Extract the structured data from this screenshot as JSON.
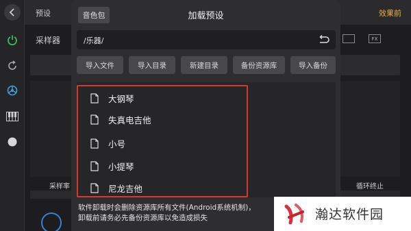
{
  "topbar": {
    "preset_label": "预设",
    "effect_label": "效果前"
  },
  "background": {
    "sampler_label": "采样器",
    "rate_label": "采样率",
    "loop_label": "循环终止",
    "fx_label": "FX"
  },
  "dialog": {
    "pack_button": "音色包",
    "title": "加载预设",
    "path": "/乐器/",
    "actions": [
      {
        "label": "导入文件"
      },
      {
        "label": "导入目录"
      },
      {
        "label": "新建目录"
      },
      {
        "label": "备份资源库"
      },
      {
        "label": "导入备份"
      }
    ],
    "files": [
      {
        "name": "大钢琴"
      },
      {
        "name": "失真电吉他"
      },
      {
        "name": "小号"
      },
      {
        "name": "小提琴"
      },
      {
        "name": "尼龙吉他"
      }
    ],
    "note_line1": "软件卸载时会删除资源库所有文件(Android系统机制)，",
    "note_line2": "卸载前请务必先备份资源库以免造成损失"
  },
  "watermark": {
    "text": "瀚达软件园"
  },
  "colors": {
    "highlight": "#d43a2e",
    "accent_orange": "#e7b24a",
    "power_green": "#3fbf5a"
  }
}
